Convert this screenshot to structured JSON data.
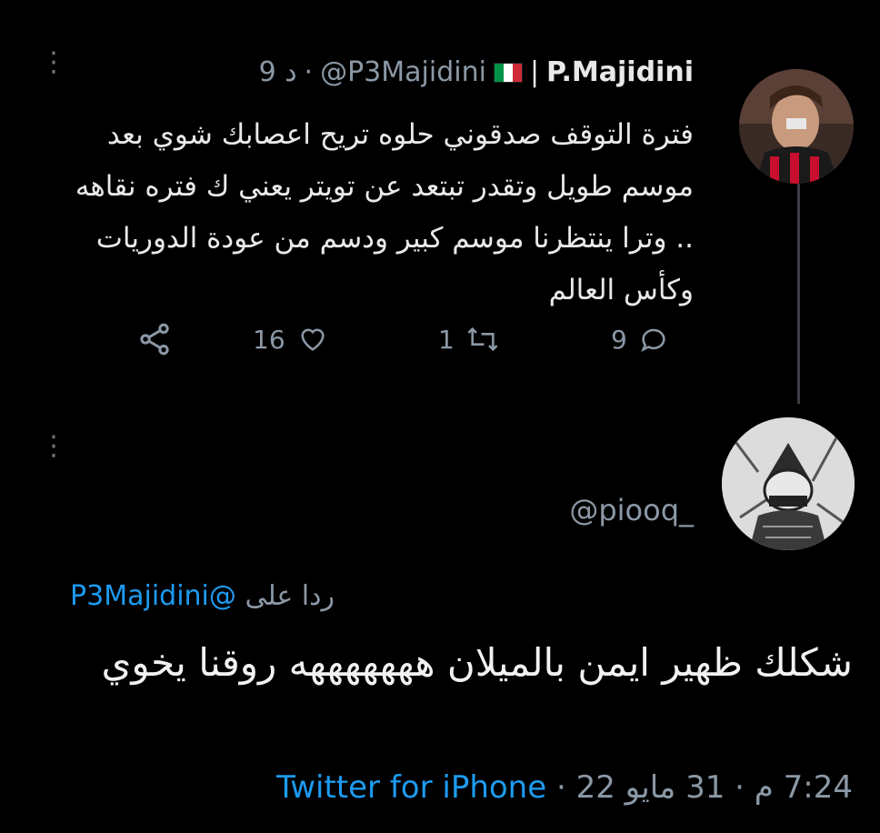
{
  "tweet": {
    "display_name": "P.Majidini",
    "separator": "|",
    "handle": "@P3Majidini",
    "time": "9 د",
    "text": "فترة التوقف صدقوني حلوه تريح اعصابك شوي بعد موسم طويل وتقدر تبتعد عن تويتر يعني ك فتره نقاهه .. وترا ينتظرنا موسم كبير ودسم من عودة الدوريات وكأس العالم",
    "replies": "9",
    "retweets": "1",
    "likes": "16"
  },
  "reply": {
    "handle": "@piooq_",
    "reply_to_label": "ردا على",
    "reply_to_handle": "@P3Majidini",
    "text": "شكلك ظهير ايمن بالميلان هههههههه روقنا يخوي",
    "time": "7:24 م",
    "date": "31 مايو 22",
    "source": "Twitter for iPhone"
  },
  "colors": {
    "background": "#000000",
    "link": "#1d9bf0",
    "muted": "#8b98a5",
    "thread_line": "#3b3f44"
  },
  "icons": [
    "more-vertical-icon",
    "italy-flag-icon",
    "reply-icon",
    "retweet-icon",
    "like-icon",
    "share-icon"
  ]
}
